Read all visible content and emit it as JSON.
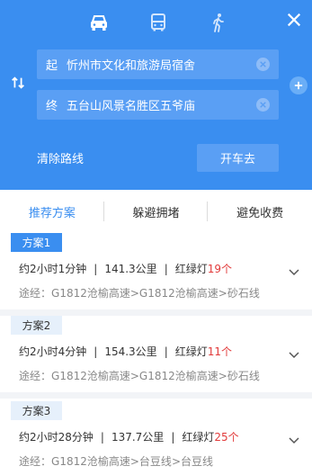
{
  "header": {
    "modes": [
      {
        "name": "car",
        "icon": "car-icon"
      },
      {
        "name": "bus",
        "icon": "bus-icon"
      },
      {
        "name": "walk",
        "icon": "walk-icon"
      }
    ],
    "start_tag": "起",
    "start_value": "忻州市文化和旅游局宿舍",
    "end_tag": "终",
    "end_value": "五台山风景名胜区五爷庙",
    "clear_route_label": "清除路线",
    "drive_button_label": "开车去",
    "accent_color": "#3a8ef0"
  },
  "tabs": [
    {
      "label": "推荐方案",
      "active": true
    },
    {
      "label": "躲避拥堵",
      "active": false
    },
    {
      "label": "避免收费",
      "active": false
    }
  ],
  "plans": [
    {
      "label": "方案1",
      "time": "约2小时1分钟",
      "distance": "141.3公里",
      "lights_label": "红绿灯",
      "lights_count": "19个",
      "via_label": "途经：",
      "via": [
        "G1812沧榆高速",
        "G1812沧榆高速",
        "砂石线"
      ]
    },
    {
      "label": "方案2",
      "time": "约2小时4分钟",
      "distance": "154.3公里",
      "lights_label": "红绿灯",
      "lights_count": "11个",
      "via_label": "途经：",
      "via": [
        "G1812沧榆高速",
        "G1812沧榆高速",
        "砂石线"
      ]
    },
    {
      "label": "方案3",
      "time": "约2小时28分钟",
      "distance": "137.7公里",
      "lights_label": "红绿灯",
      "lights_count": "25个",
      "via_label": "途经：",
      "via": [
        "G1812沧榆高速",
        "台豆线",
        "台豆线"
      ]
    }
  ],
  "separators": {
    "pipe": "|",
    "arrow": ">"
  }
}
